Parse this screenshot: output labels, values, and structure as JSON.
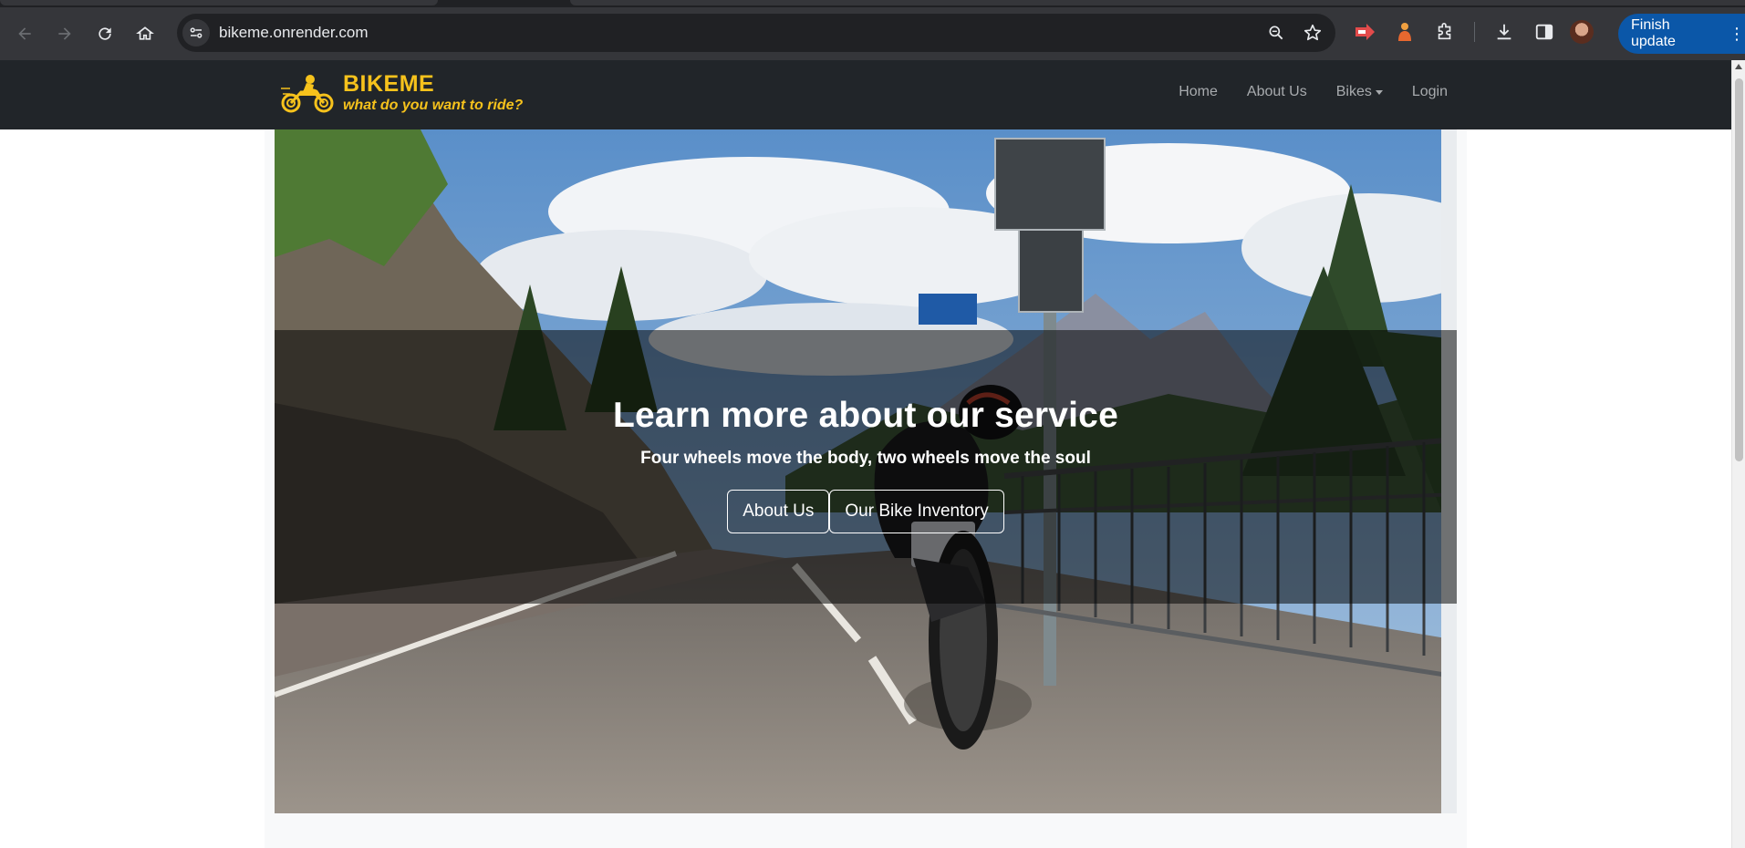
{
  "browser": {
    "url": "bikeme.onrender.com",
    "finish_update_label": "Finish update"
  },
  "navbar": {
    "brand_name": "BIKEME",
    "tagline": "what do you want to ride?",
    "links": [
      "Home",
      "About Us",
      "Bikes",
      "Login"
    ]
  },
  "hero": {
    "title": "Learn more about our service",
    "subtitle": "Four wheels move the body, two wheels move the soul",
    "buttons": [
      "About Us",
      "Our Bike Inventory"
    ]
  },
  "colors": {
    "brand_yellow": "#f6c21c",
    "navbar_bg": "#212529",
    "chrome_bg": "#35363a",
    "update_button": "#0b57a8"
  }
}
